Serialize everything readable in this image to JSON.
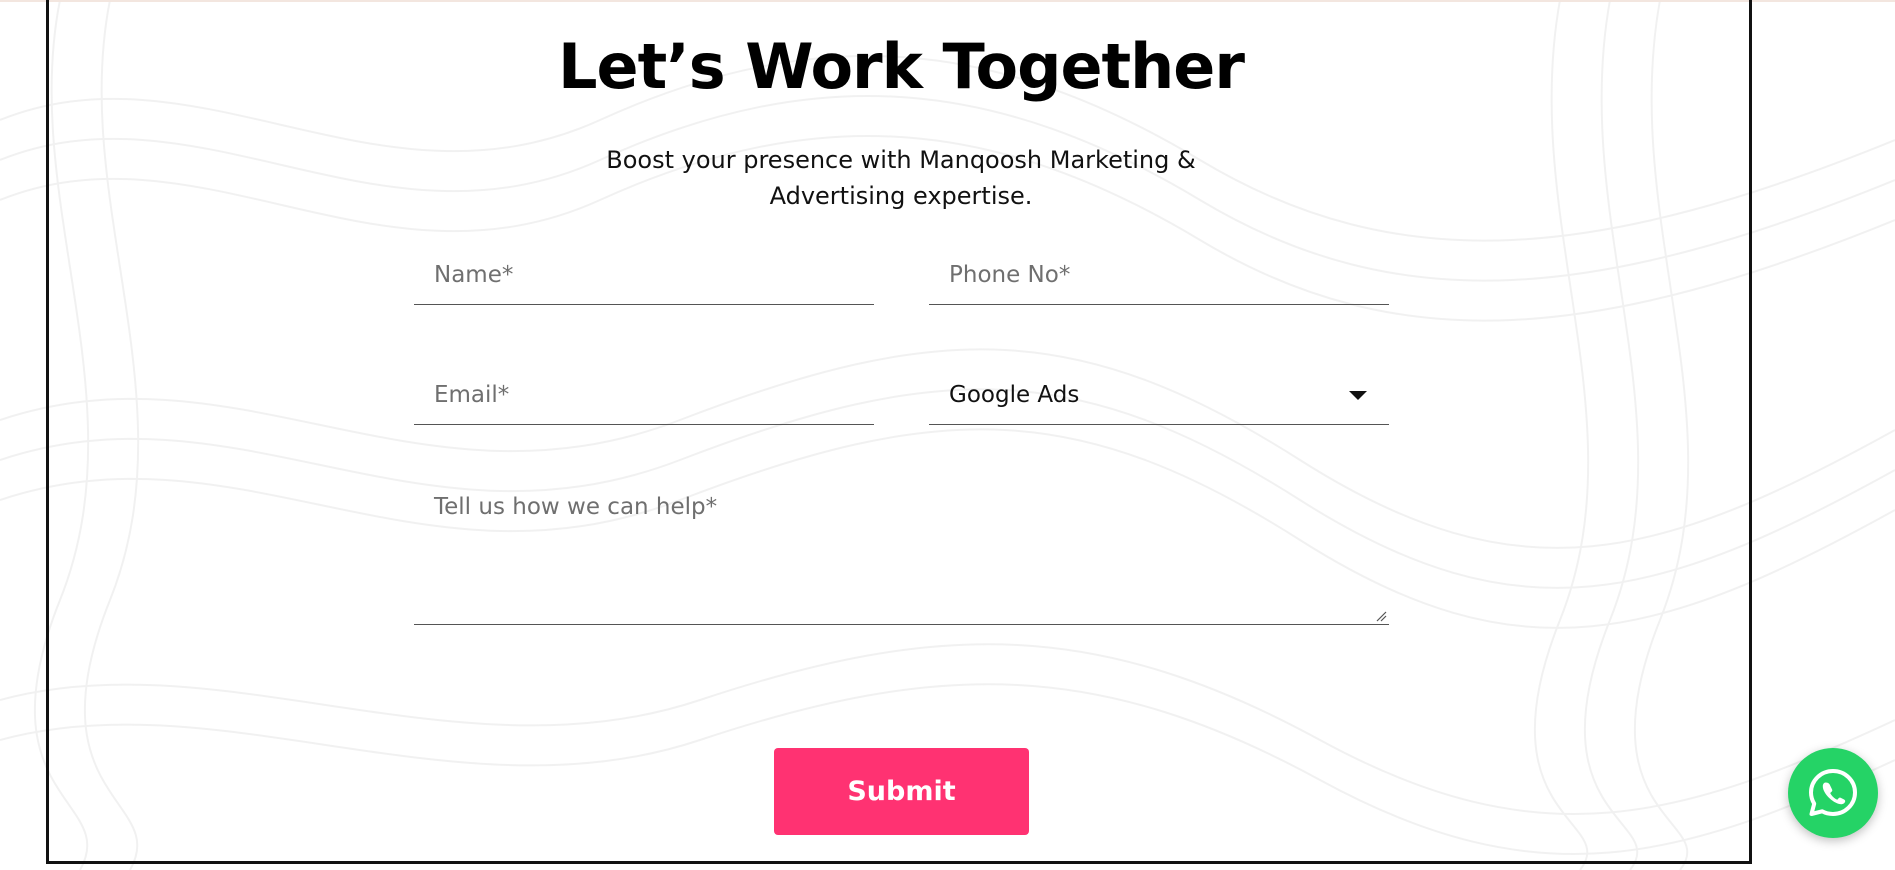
{
  "page": {
    "title": "Let’s Work Together",
    "subtitle": "Boost your presence with Manqoosh Marketing & Advertising expertise."
  },
  "form": {
    "name_placeholder": "Name*",
    "phone_placeholder": "Phone No*",
    "email_placeholder": "Email*",
    "service_selected": "Google Ads",
    "message_placeholder": "Tell us how we can help*",
    "submit_label": "Submit"
  },
  "icons": {
    "dropdown": "caret-down-icon",
    "chat": "whatsapp-icon",
    "textarea_resize": "resize-grip-icon"
  },
  "colors": {
    "accent": "#ff3272",
    "whatsapp": "#25d366",
    "text": "#000000",
    "placeholder": "#6f6f6f"
  }
}
